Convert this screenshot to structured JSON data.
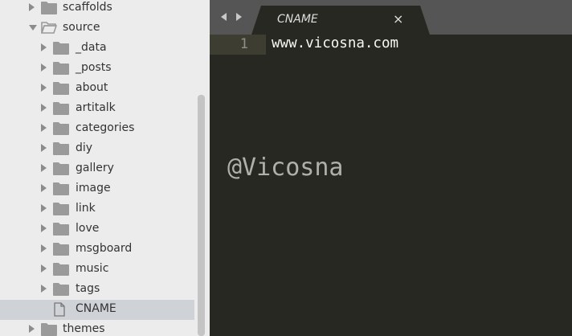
{
  "sidebar": {
    "items": [
      {
        "label": "scaffolds",
        "type": "folder",
        "expanded": false,
        "depth": 0
      },
      {
        "label": "source",
        "type": "folder",
        "expanded": true,
        "depth": 0
      },
      {
        "label": "_data",
        "type": "folder",
        "expanded": false,
        "depth": 1
      },
      {
        "label": "_posts",
        "type": "folder",
        "expanded": false,
        "depth": 1
      },
      {
        "label": "about",
        "type": "folder",
        "expanded": false,
        "depth": 1
      },
      {
        "label": "artitalk",
        "type": "folder",
        "expanded": false,
        "depth": 1
      },
      {
        "label": "categories",
        "type": "folder",
        "expanded": false,
        "depth": 1
      },
      {
        "label": "diy",
        "type": "folder",
        "expanded": false,
        "depth": 1
      },
      {
        "label": "gallery",
        "type": "folder",
        "expanded": false,
        "depth": 1
      },
      {
        "label": "image",
        "type": "folder",
        "expanded": false,
        "depth": 1
      },
      {
        "label": "link",
        "type": "folder",
        "expanded": false,
        "depth": 1
      },
      {
        "label": "love",
        "type": "folder",
        "expanded": false,
        "depth": 1
      },
      {
        "label": "msgboard",
        "type": "folder",
        "expanded": false,
        "depth": 1
      },
      {
        "label": "music",
        "type": "folder",
        "expanded": false,
        "depth": 1
      },
      {
        "label": "tags",
        "type": "folder",
        "expanded": false,
        "depth": 1
      },
      {
        "label": "CNAME",
        "type": "file",
        "selected": true,
        "depth": 1
      },
      {
        "label": "themes",
        "type": "folder",
        "expanded": false,
        "depth": 0
      }
    ]
  },
  "tab": {
    "title": "CNAME",
    "close_icon": "×"
  },
  "editor": {
    "lines": [
      {
        "number": "1",
        "text": "www.vicosna.com"
      }
    ]
  },
  "watermark": {
    "text": "@Vicosna"
  },
  "colors": {
    "editor_bg": "#272822",
    "tabbar_bg": "#555555",
    "sidebar_bg": "#ececec",
    "selected_row": "#cfd2d7",
    "folder_icon": "#9a9a9a"
  }
}
